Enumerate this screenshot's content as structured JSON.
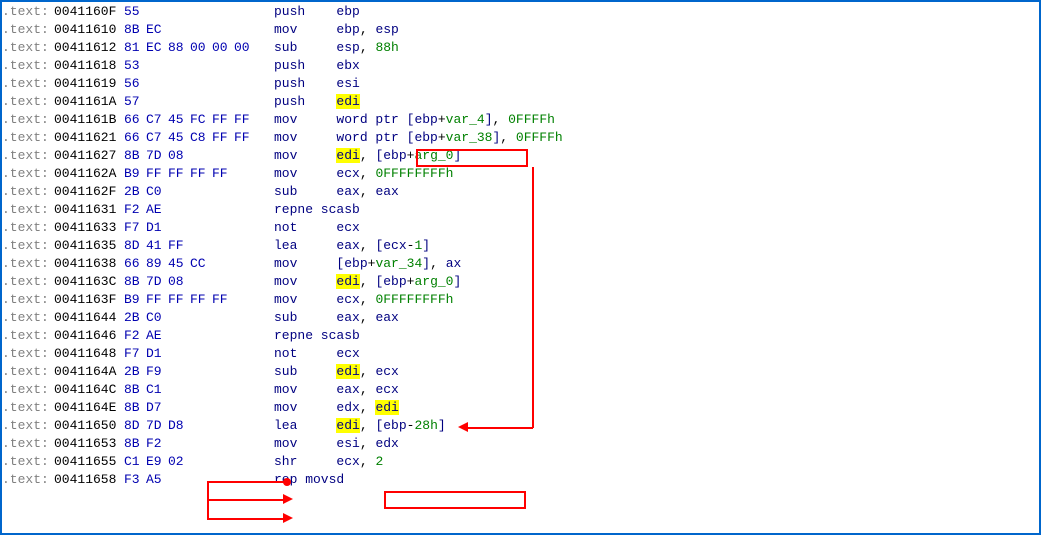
{
  "rows": [
    {
      "addr": "0041160F",
      "bytes": [
        "55",
        "",
        "",
        "",
        "",
        ""
      ],
      "mnemonic": "push",
      "ops": [
        {
          "t": "ebp",
          "c": "nv"
        }
      ]
    },
    {
      "addr": "00411610",
      "bytes": [
        "8B",
        "EC",
        "",
        "",
        "",
        ""
      ],
      "mnemonic": "mov",
      "ops": [
        {
          "t": "ebp",
          "c": "nv"
        },
        {
          "t": ", "
        },
        {
          "t": "esp",
          "c": "nv"
        }
      ]
    },
    {
      "addr": "00411612",
      "bytes": [
        "81",
        "EC",
        "88",
        "00",
        "00",
        "00"
      ],
      "mnemonic": "sub",
      "ops": [
        {
          "t": "esp",
          "c": "nv"
        },
        {
          "t": ", "
        },
        {
          "t": "88h",
          "c": "gr"
        }
      ]
    },
    {
      "addr": "00411618",
      "bytes": [
        "53",
        "",
        "",
        "",
        "",
        ""
      ],
      "mnemonic": "push",
      "ops": [
        {
          "t": "ebx",
          "c": "nv"
        }
      ]
    },
    {
      "addr": "00411619",
      "bytes": [
        "56",
        "",
        "",
        "",
        "",
        ""
      ],
      "mnemonic": "push",
      "ops": [
        {
          "t": "esi",
          "c": "nv"
        }
      ]
    },
    {
      "addr": "0041161A",
      "bytes": [
        "57",
        "",
        "",
        "",
        "",
        ""
      ],
      "mnemonic": "push",
      "ops": [
        {
          "t": "edi",
          "c": "hl"
        }
      ]
    },
    {
      "addr": "0041161B",
      "bytes": [
        "66",
        "C7",
        "45",
        "FC",
        "FF",
        "FF"
      ],
      "mnemonic": "mov",
      "ops": [
        {
          "t": "word ptr ",
          "c": "nv"
        },
        {
          "t": "[",
          "c": "nv"
        },
        {
          "t": "ebp",
          "c": "nv"
        },
        {
          "t": "+"
        },
        {
          "t": "var_4",
          "c": "gr"
        },
        {
          "t": "]",
          "c": "nv"
        },
        {
          "t": ", "
        },
        {
          "t": "0FFFFh",
          "c": "gr"
        }
      ]
    },
    {
      "addr": "00411621",
      "bytes": [
        "66",
        "C7",
        "45",
        "C8",
        "FF",
        "FF"
      ],
      "mnemonic": "mov",
      "ops": [
        {
          "t": "word ptr ",
          "c": "nv"
        },
        {
          "t": "[",
          "c": "nv"
        },
        {
          "t": "ebp",
          "c": "nv"
        },
        {
          "t": "+"
        },
        {
          "t": "var_38",
          "c": "gr"
        },
        {
          "t": "]",
          "c": "nv"
        },
        {
          "t": ", "
        },
        {
          "t": "0FFFFh",
          "c": "gr"
        }
      ]
    },
    {
      "addr": "00411627",
      "bytes": [
        "8B",
        "7D",
        "08",
        "",
        "",
        ""
      ],
      "mnemonic": "mov",
      "ops": [
        {
          "t": "edi",
          "c": "hl"
        },
        {
          "t": ", "
        },
        {
          "t": "[",
          "c": "nv"
        },
        {
          "t": "ebp",
          "c": "nv"
        },
        {
          "t": "+"
        },
        {
          "t": "arg_0",
          "c": "gr"
        },
        {
          "t": "]",
          "c": "nv"
        }
      ]
    },
    {
      "addr": "0041162A",
      "bytes": [
        "B9",
        "FF",
        "FF",
        "FF",
        "FF",
        ""
      ],
      "mnemonic": "mov",
      "ops": [
        {
          "t": "ecx",
          "c": "nv"
        },
        {
          "t": ", "
        },
        {
          "t": "0FFFFFFFFh",
          "c": "gr"
        }
      ]
    },
    {
      "addr": "0041162F",
      "bytes": [
        "2B",
        "C0",
        "",
        "",
        "",
        ""
      ],
      "mnemonic": "sub",
      "ops": [
        {
          "t": "eax",
          "c": "nv"
        },
        {
          "t": ", "
        },
        {
          "t": "eax",
          "c": "nv"
        }
      ]
    },
    {
      "addr": "00411631",
      "bytes": [
        "F2",
        "AE",
        "",
        "",
        "",
        ""
      ],
      "mnemonic": "repne scasb",
      "ops": []
    },
    {
      "addr": "00411633",
      "bytes": [
        "F7",
        "D1",
        "",
        "",
        "",
        ""
      ],
      "mnemonic": "not",
      "ops": [
        {
          "t": "ecx",
          "c": "nv"
        }
      ]
    },
    {
      "addr": "00411635",
      "bytes": [
        "8D",
        "41",
        "FF",
        "",
        "",
        ""
      ],
      "mnemonic": "lea",
      "ops": [
        {
          "t": "eax",
          "c": "nv"
        },
        {
          "t": ", "
        },
        {
          "t": "[",
          "c": "nv"
        },
        {
          "t": "ecx",
          "c": "nv"
        },
        {
          "t": "-"
        },
        {
          "t": "1",
          "c": "gr"
        },
        {
          "t": "]",
          "c": "nv"
        }
      ]
    },
    {
      "addr": "00411638",
      "bytes": [
        "66",
        "89",
        "45",
        "CC",
        "",
        ""
      ],
      "mnemonic": "mov",
      "ops": [
        {
          "t": "[",
          "c": "nv"
        },
        {
          "t": "ebp",
          "c": "nv"
        },
        {
          "t": "+"
        },
        {
          "t": "var_34",
          "c": "gr"
        },
        {
          "t": "]",
          "c": "nv"
        },
        {
          "t": ", "
        },
        {
          "t": "ax",
          "c": "nv"
        }
      ]
    },
    {
      "addr": "0041163C",
      "bytes": [
        "8B",
        "7D",
        "08",
        "",
        "",
        ""
      ],
      "mnemonic": "mov",
      "ops": [
        {
          "t": "edi",
          "c": "hl"
        },
        {
          "t": ", "
        },
        {
          "t": "[",
          "c": "nv"
        },
        {
          "t": "ebp",
          "c": "nv"
        },
        {
          "t": "+"
        },
        {
          "t": "arg_0",
          "c": "gr"
        },
        {
          "t": "]",
          "c": "nv"
        }
      ]
    },
    {
      "addr": "0041163F",
      "bytes": [
        "B9",
        "FF",
        "FF",
        "FF",
        "FF",
        ""
      ],
      "mnemonic": "mov",
      "ops": [
        {
          "t": "ecx",
          "c": "nv"
        },
        {
          "t": ", "
        },
        {
          "t": "0FFFFFFFFh",
          "c": "gr"
        }
      ]
    },
    {
      "addr": "00411644",
      "bytes": [
        "2B",
        "C0",
        "",
        "",
        "",
        ""
      ],
      "mnemonic": "sub",
      "ops": [
        {
          "t": "eax",
          "c": "nv"
        },
        {
          "t": ", "
        },
        {
          "t": "eax",
          "c": "nv"
        }
      ]
    },
    {
      "addr": "00411646",
      "bytes": [
        "F2",
        "AE",
        "",
        "",
        "",
        ""
      ],
      "mnemonic": "repne scasb",
      "ops": []
    },
    {
      "addr": "00411648",
      "bytes": [
        "F7",
        "D1",
        "",
        "",
        "",
        ""
      ],
      "mnemonic": "not",
      "ops": [
        {
          "t": "ecx",
          "c": "nv"
        }
      ]
    },
    {
      "addr": "0041164A",
      "bytes": [
        "2B",
        "F9",
        "",
        "",
        "",
        ""
      ],
      "mnemonic": "sub",
      "ops": [
        {
          "t": "edi",
          "c": "hl"
        },
        {
          "t": ", "
        },
        {
          "t": "ecx",
          "c": "nv"
        }
      ]
    },
    {
      "addr": "0041164C",
      "bytes": [
        "8B",
        "C1",
        "",
        "",
        "",
        ""
      ],
      "mnemonic": "mov",
      "ops": [
        {
          "t": "eax",
          "c": "nv"
        },
        {
          "t": ", "
        },
        {
          "t": "ecx",
          "c": "nv"
        }
      ]
    },
    {
      "addr": "0041164E",
      "bytes": [
        "8B",
        "D7",
        "",
        "",
        "",
        ""
      ],
      "mnemonic": "mov",
      "ops": [
        {
          "t": "edx",
          "c": "nv"
        },
        {
          "t": ", "
        },
        {
          "t": "edi",
          "c": "hl"
        }
      ]
    },
    {
      "addr": "00411650",
      "bytes": [
        "8D",
        "7D",
        "D8",
        "",
        "",
        ""
      ],
      "mnemonic": "lea",
      "ops": [
        {
          "t": "edi",
          "c": "hl"
        },
        {
          "t": ", "
        },
        {
          "t": "[",
          "c": "nv"
        },
        {
          "t": "ebp",
          "c": "nv"
        },
        {
          "t": "-"
        },
        {
          "t": "28h",
          "c": "gr"
        },
        {
          "t": "]",
          "c": "nv"
        }
      ]
    },
    {
      "addr": "00411653",
      "bytes": [
        "8B",
        "F2",
        "",
        "",
        "",
        ""
      ],
      "mnemonic": "mov",
      "ops": [
        {
          "t": "esi",
          "c": "nv"
        },
        {
          "t": ", "
        },
        {
          "t": "edx",
          "c": "nv"
        }
      ]
    },
    {
      "addr": "00411655",
      "bytes": [
        "C1",
        "E9",
        "02",
        "",
        "",
        ""
      ],
      "mnemonic": "shr",
      "ops": [
        {
          "t": "ecx",
          "c": "nv"
        },
        {
          "t": ", "
        },
        {
          "t": "2",
          "c": "gr"
        }
      ]
    },
    {
      "addr": "00411658",
      "bytes": [
        "F3",
        "A5",
        "",
        "",
        "",
        ""
      ],
      "mnemonic": "rep movsd",
      "ops": []
    }
  ],
  "seg_prefix": ".text:",
  "mnemonic_col_width": 8
}
